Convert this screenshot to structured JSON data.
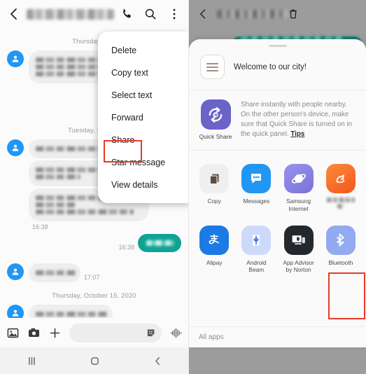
{
  "left_panel": {
    "header": {
      "back_icon": "chevron-left-icon",
      "title": "",
      "call_icon": "phone-icon",
      "search_icon": "search-icon",
      "more_icon": "overflow-menu-icon"
    },
    "thread": {
      "date_separators": [
        "Thursday, July",
        "Tuesday, Septem",
        "Thursday, October 15, 2020"
      ],
      "timestamps": [
        "16:38",
        "16:38",
        "17:07"
      ]
    },
    "context_menu": {
      "items": [
        "Delete",
        "Copy text",
        "Select text",
        "Forward",
        "Share",
        "Star message",
        "View details"
      ],
      "highlighted_item": "Share",
      "highlight_color": "#e8392a"
    },
    "compose": {
      "gallery_icon": "image-icon",
      "camera_icon": "camera-icon",
      "add_icon": "plus-icon",
      "input_placeholder": "",
      "sticker_icon": "sticker-icon",
      "voice_icon": "audio-waveform-icon"
    }
  },
  "right_panel": {
    "dim_header": {
      "back_icon": "chevron-left-icon",
      "title": "",
      "delete_icon": "trash-icon"
    },
    "share_sheet": {
      "subject": {
        "icon": "text-document-icon",
        "text": "Welcome to our city!"
      },
      "quick_share": {
        "label": "Quick Share",
        "icon": "quick-share-icon",
        "description": "Share instantly with people nearby. On the other person's device, make sure that Quick Share is turned on in the quick panel. ",
        "tips_link": "Tips",
        "brand_color": "#6a63c8"
      },
      "apps_row_1": [
        {
          "label": "Copy",
          "icon": "copy-icon",
          "color": "#efefef"
        },
        {
          "label": "Messages",
          "icon": "messages-icon",
          "color": "#2196f3"
        },
        {
          "label": "Samsung\nInternet",
          "icon": "samsung-internet-icon",
          "color": "#8b86e0"
        },
        {
          "label": "",
          "icon": "uc-browser-icon",
          "color": "#f5691f",
          "blurred": true
        }
      ],
      "apps_row_2": [
        {
          "label": "Alipay",
          "icon": "alipay-icon",
          "color": "#1b7ae4"
        },
        {
          "label": "Android\nBeam",
          "icon": "android-beam-icon",
          "color": "#c3d2f7"
        },
        {
          "label": "App Advisor\nby Norton",
          "icon": "app-advisor-icon",
          "color": "#23282d"
        },
        {
          "label": "Bluetooth",
          "icon": "bluetooth-icon",
          "color": "#93a9f0",
          "highlighted": true
        }
      ],
      "all_apps_label": "All apps",
      "highlight_color": "#e8392a"
    }
  },
  "navigation_bar": {
    "recents_icon": "recents-icon",
    "home_icon": "home-icon",
    "back_icon": "back-icon"
  },
  "app_labels": {
    "copy": "Copy",
    "messages": "Messages",
    "samsung_internet_l1": "Samsung",
    "samsung_internet_l2": "Internet",
    "alipay": "Alipay",
    "android_beam_l1": "Android",
    "android_beam_l2": "Beam",
    "app_advisor_l1": "App Advisor",
    "app_advisor_l2": "by Norton",
    "bluetooth": "Bluetooth"
  }
}
